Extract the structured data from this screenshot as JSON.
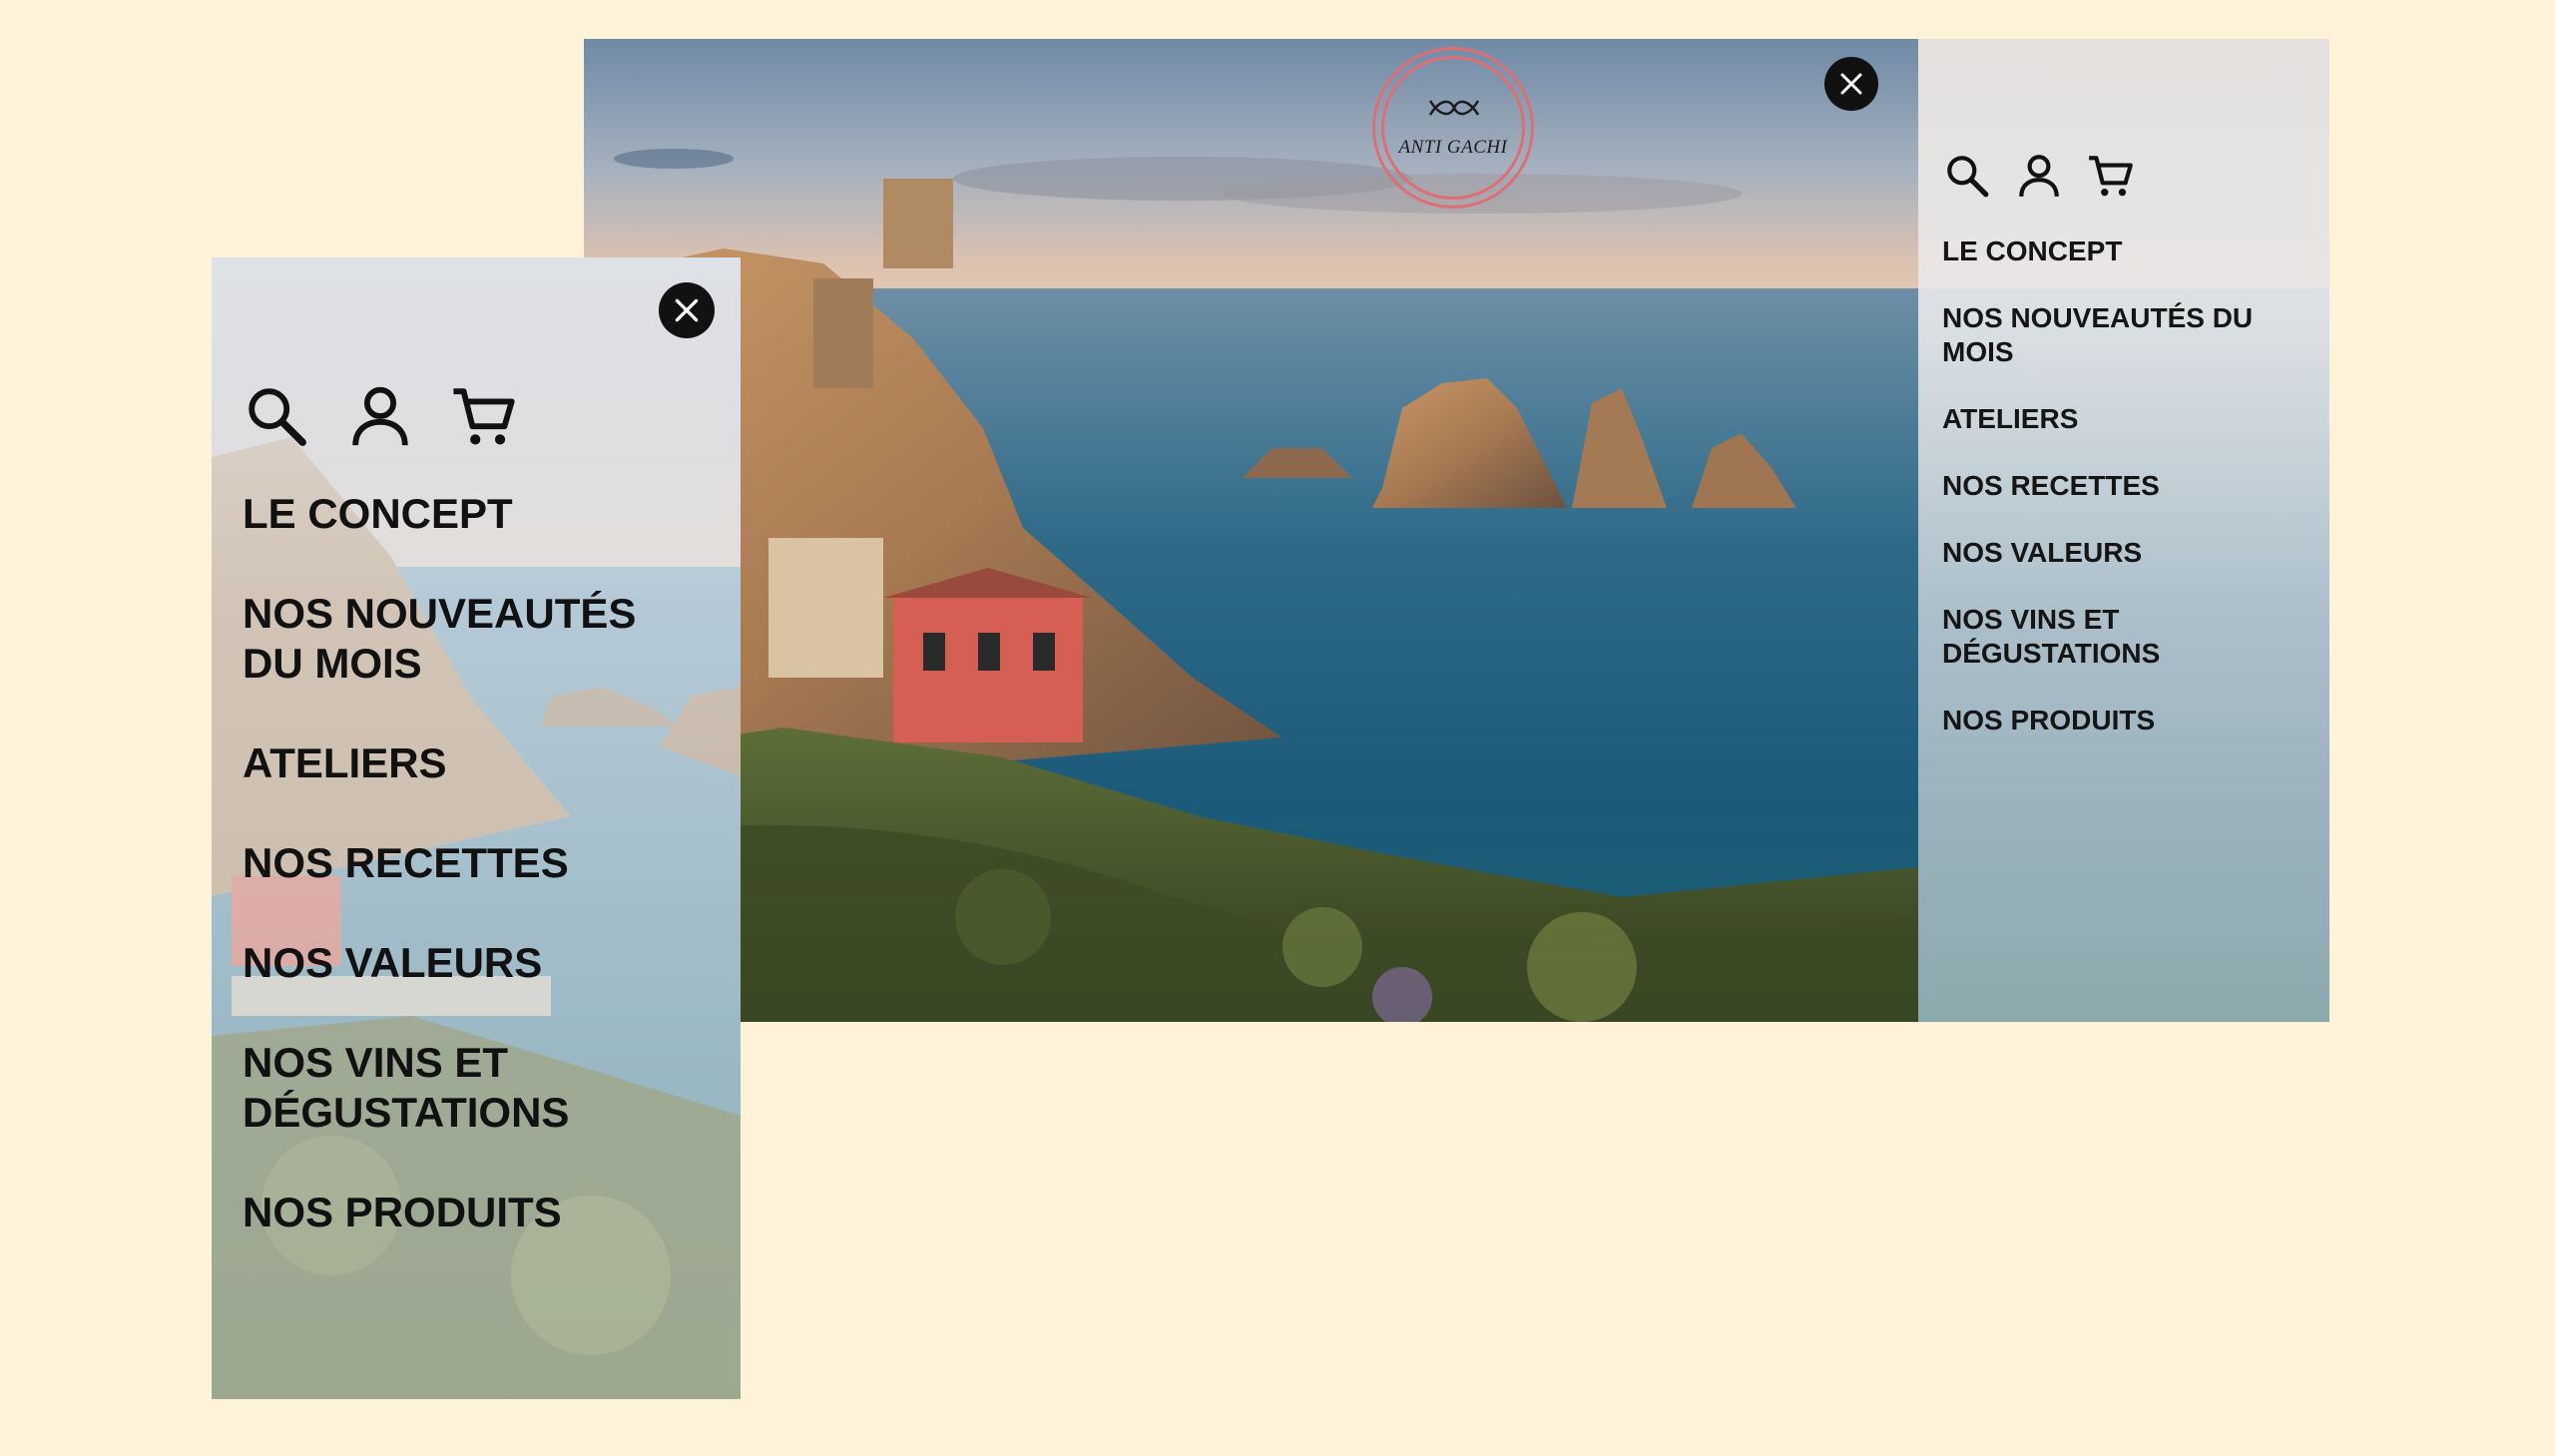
{
  "brand": {
    "logo_text": "ANTI GACHI",
    "accent_color": "#dd6f74",
    "background_color": "#fef2d8"
  },
  "menu": {
    "icons": [
      "search-icon",
      "user-icon",
      "cart-icon"
    ],
    "close_icon": "close-icon",
    "items": [
      {
        "label": "LE CONCEPT"
      },
      {
        "label": "NOS NOUVEAUTÉS DU MOIS"
      },
      {
        "label": "ATELIERS"
      },
      {
        "label": "NOS RECETTES"
      },
      {
        "label": "NOS VALEURS"
      },
      {
        "label": "NOS VINS ET DÉGUSTATIONS"
      },
      {
        "label": "NOS PRODUITS"
      }
    ]
  }
}
